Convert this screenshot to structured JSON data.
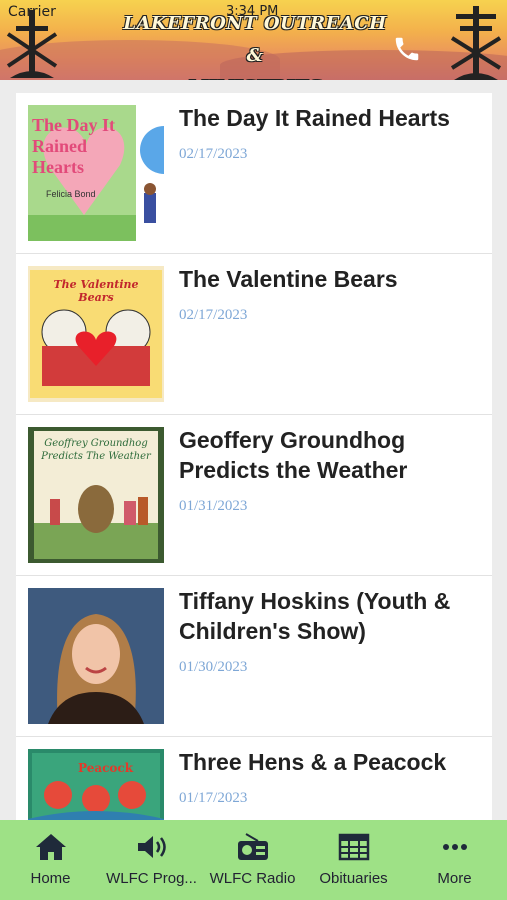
{
  "status": {
    "carrier": "Carrier",
    "time": "3:34 PM"
  },
  "header": {
    "title_line1": "LAKEFRONT OUTREACH &",
    "title_line2": "MINISTRIES",
    "call_icon": "phone-icon"
  },
  "items": [
    {
      "title": "The Day It Rained Hearts",
      "date": "02/17/2023",
      "thumb": {
        "text": "The Day It Rained Hearts",
        "author": "Felicia Bond"
      }
    },
    {
      "title": "The Valentine Bears",
      "date": "02/17/2023",
      "thumb": {
        "text": "The Valentine Bears"
      }
    },
    {
      "title": "Geoffery Groundhog Predicts the Weather",
      "date": "01/31/2023",
      "thumb": {
        "text": "Geoffrey Groundhog Predicts The Weather"
      }
    },
    {
      "title": "Tiffany Hoskins (Youth & Children's Show)",
      "date": "01/30/2023"
    },
    {
      "title": "Three Hens & a Peacock",
      "date": "01/17/2023",
      "thumb": {
        "text": "Peacock"
      }
    }
  ],
  "tabs": [
    {
      "label": "Home",
      "icon": "home-icon"
    },
    {
      "label": "WLFC Prog...",
      "icon": "speaker-icon"
    },
    {
      "label": "WLFC Radio",
      "icon": "radio-icon"
    },
    {
      "label": "Obituaries",
      "icon": "newspaper-icon"
    },
    {
      "label": "More",
      "icon": "more-icon"
    }
  ],
  "colors": {
    "tabbar": "#9ee186",
    "date": "#7ea7d6",
    "header_top": "#f7d24f",
    "header_bottom": "#d97a77"
  }
}
